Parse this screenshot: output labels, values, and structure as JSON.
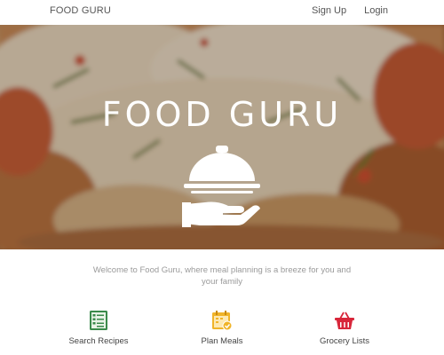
{
  "nav": {
    "brand": "FOOD GURU",
    "links": [
      {
        "label": "Sign Up"
      },
      {
        "label": "Login"
      }
    ]
  },
  "hero": {
    "title": "FOOD GURU",
    "icon": "serving-cloche-hand-icon"
  },
  "tagline": "Welcome to Food Guru, where meal planning is a breeze for you and your family",
  "features": [
    {
      "label": "Search Recipes",
      "icon": "recipe-list-icon",
      "color": "#3a8a4a"
    },
    {
      "label": "Plan Meals",
      "icon": "calendar-check-icon",
      "color": "#f0b429"
    },
    {
      "label": "Grocery Lists",
      "icon": "shopping-basket-icon",
      "color": "#d8263a"
    }
  ]
}
